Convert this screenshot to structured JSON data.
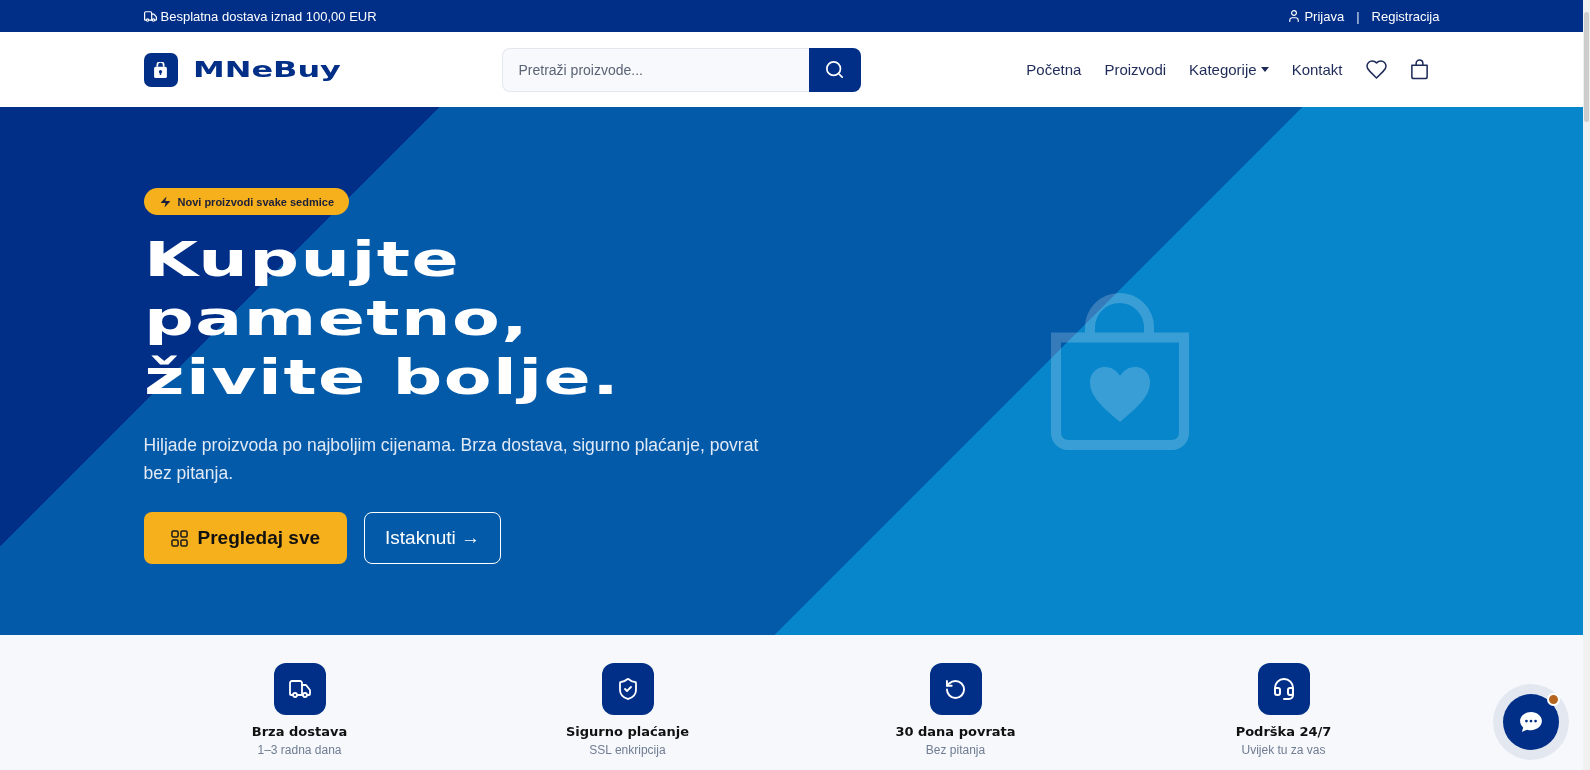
{
  "top_bar": {
    "notice": "Besplatna dostava iznad 100,00 EUR",
    "login": "Prijava",
    "separator": "|",
    "register": "Registracija"
  },
  "header": {
    "logo": "MNeBuy",
    "search": {
      "placeholder": "Pretraži proizvode..."
    },
    "nav": [
      {
        "label": "Početna",
        "dropdown": false
      },
      {
        "label": "Proizvodi",
        "dropdown": false
      },
      {
        "label": "Kategorije",
        "dropdown": true
      },
      {
        "label": "Kontakt",
        "dropdown": false
      }
    ]
  },
  "hero": {
    "badge": "Novi proizvodi svake sedmice",
    "heading": [
      "Kupujte",
      "pametno,",
      "živite bolje."
    ],
    "description": "Hiljade proizvoda po najboljim cijenama. Brza dostava, sigurno plaćanje, povrat bez pitanja.",
    "buttons": [
      {
        "label": "Pregledaj sve",
        "kind": "primary"
      },
      {
        "label": "Istaknuti →",
        "kind": "outline"
      }
    ]
  },
  "features": [
    {
      "title": "Brza dostava",
      "subtitle": "1–3 radna dana"
    },
    {
      "title": "Sigurno plaćanje",
      "subtitle": "SSL enkripcija"
    },
    {
      "title": "30 dana povrata",
      "subtitle": "Bez pitanja"
    },
    {
      "title": "Podrška 24/7",
      "subtitle": "Uvijek tu za vas"
    }
  ]
}
